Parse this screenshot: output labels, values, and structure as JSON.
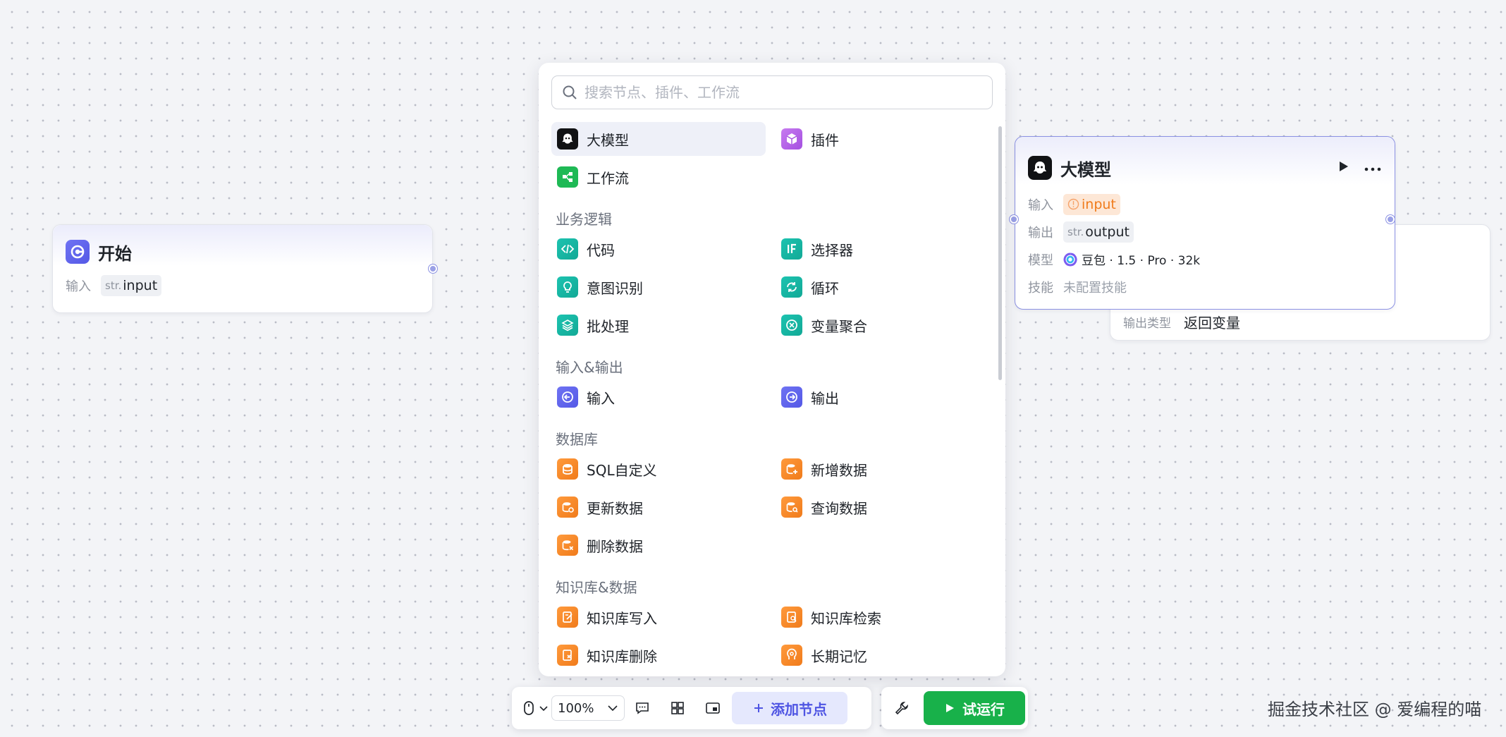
{
  "start_node": {
    "title": "开始",
    "input_label": "输入",
    "input_type": "str.",
    "input_name": "input"
  },
  "end_node": {
    "output_type_label": "输出类型",
    "output_type_value": "返回变量"
  },
  "llm_node": {
    "title": "大模型",
    "input_label": "输入",
    "input_name": "input",
    "output_label": "输出",
    "output_type": "str.",
    "output_name": "output",
    "model_label": "模型",
    "model_value": "豆包 · 1.5 · Pro · 32k",
    "skill_label": "技能",
    "skill_value": "未配置技能"
  },
  "panel": {
    "search_placeholder": "搜索节点、插件、工作流",
    "top_items": [
      "大模型",
      "插件",
      "工作流"
    ],
    "categories": [
      "业务逻辑",
      "输入&输出",
      "数据库",
      "知识库&数据"
    ],
    "logic_items": [
      "代码",
      "选择器",
      "意图识别",
      "循环",
      "批处理",
      "变量聚合"
    ],
    "io_items": [
      "输入",
      "输出"
    ],
    "db_items": [
      "SQL自定义",
      "新增数据",
      "更新数据",
      "查询数据",
      "删除数据"
    ],
    "kb_items": [
      "知识库写入",
      "知识库检索",
      "知识库删除",
      "长期记忆"
    ]
  },
  "toolbar": {
    "zoom": "100%",
    "add_node_label": "添加节点",
    "run_label": "试运行"
  },
  "watermark": "掘金技术社区 @ 爱编程的喵",
  "colors": {
    "accent": "#4f55e3",
    "run_green": "#18b14a",
    "warning_orange": "#f07b1b",
    "port": "#9aa0e6"
  }
}
